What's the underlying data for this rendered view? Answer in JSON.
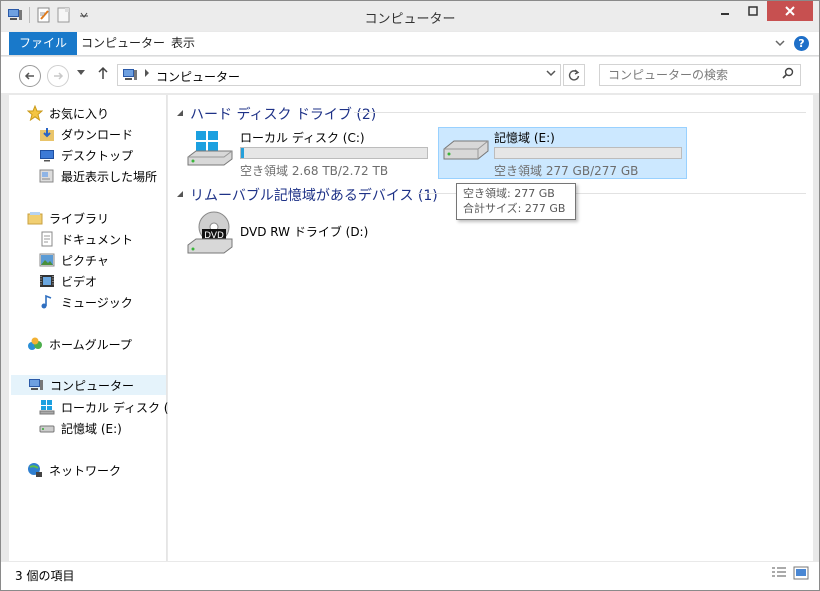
{
  "window": {
    "title": "コンピューター"
  },
  "ribbon": {
    "tabs": [
      "ファイル",
      "コンピューター",
      "表示"
    ]
  },
  "address": {
    "breadcrumb": "コンピューター",
    "search_placeholder": "コンピューターの検索"
  },
  "nav": {
    "favorites": {
      "label": "お気に入り",
      "items": [
        "ダウンロード",
        "デスクトップ",
        "最近表示した場所"
      ]
    },
    "libraries": {
      "label": "ライブラリ",
      "items": [
        "ドキュメント",
        "ピクチャ",
        "ビデオ",
        "ミュージック"
      ]
    },
    "homegroup": "ホームグループ",
    "computer": {
      "label": "コンピューター",
      "items": [
        "ローカル ディスク (C:)",
        "記憶域 (E:)"
      ]
    },
    "network": "ネットワーク"
  },
  "content": {
    "groups": [
      {
        "title": "ハード ディスク ドライブ (2)"
      },
      {
        "title": "リムーバブル記憶域があるデバイス (1)"
      }
    ],
    "drives": [
      {
        "name": "ローカル ディスク (C:)",
        "free_text": "空き領域 2.68 TB/2.72 TB",
        "used_fraction": 0.015
      },
      {
        "name": "記憶域 (E:)",
        "free_text": "空き領域 277 GB/277 GB",
        "used_fraction": 0.0
      },
      {
        "name": "DVD RW ドライブ (D:)"
      }
    ],
    "tooltip": {
      "line1": "空き領域: 277 GB",
      "line2": "合計サイズ: 277 GB"
    },
    "dvd_label": "DVD"
  },
  "statusbar": {
    "text": "3 個の項目"
  },
  "colors": {
    "accent": "#1979ca",
    "group_title": "#1e3287",
    "selection": "#cce8ff",
    "bar_fill": "#26a0da"
  }
}
